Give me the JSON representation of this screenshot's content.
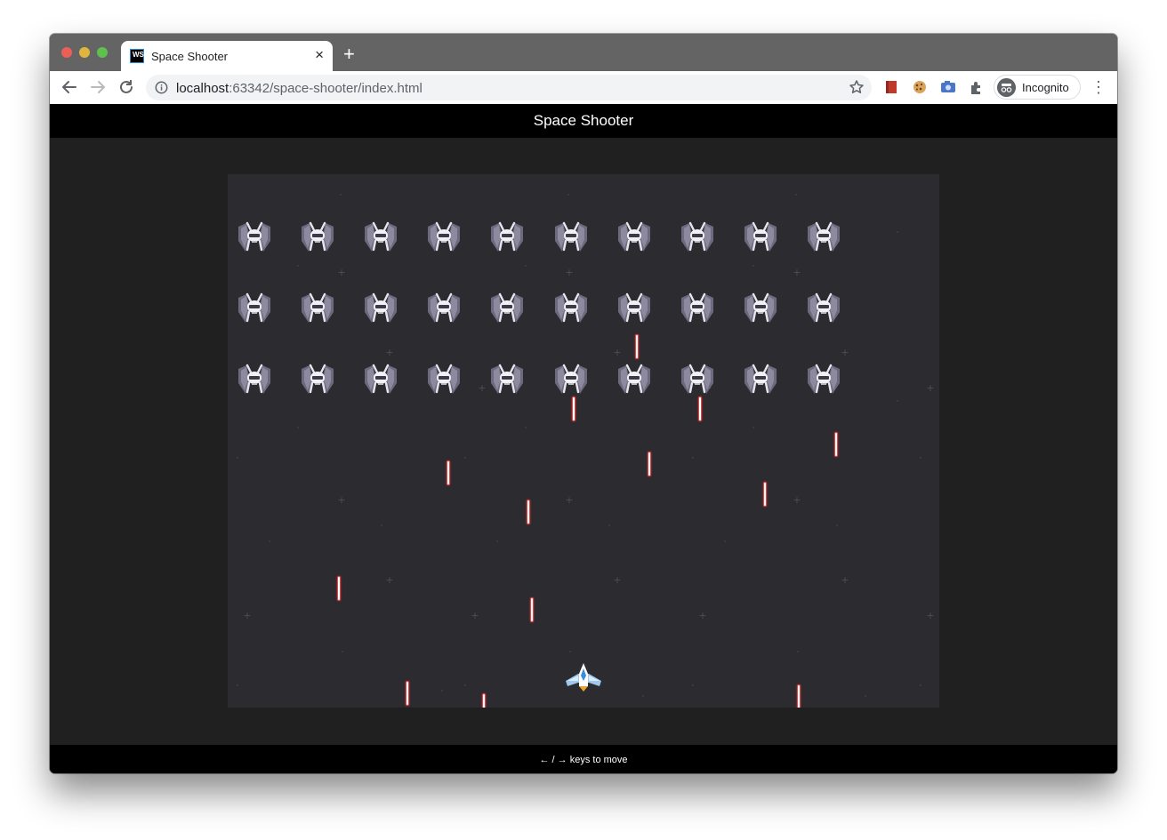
{
  "browser": {
    "tab_title": "Space Shooter",
    "tab_favicon_text": "WS",
    "tab_close": "×",
    "new_tab": "+",
    "url_host": "localhost",
    "url_rest": ":63342/space-shooter/index.html",
    "profile_label": "Incognito",
    "menu": "⋮"
  },
  "page": {
    "header_title": "Space Shooter",
    "footer_hint": "← / → keys to move"
  },
  "game": {
    "enemy_rows": 3,
    "enemy_columns": 10,
    "player_ship": "player-ship",
    "enemy_ship": "enemy-ship",
    "laser_color": "#e04848",
    "background_color": "#2b2b30"
  }
}
